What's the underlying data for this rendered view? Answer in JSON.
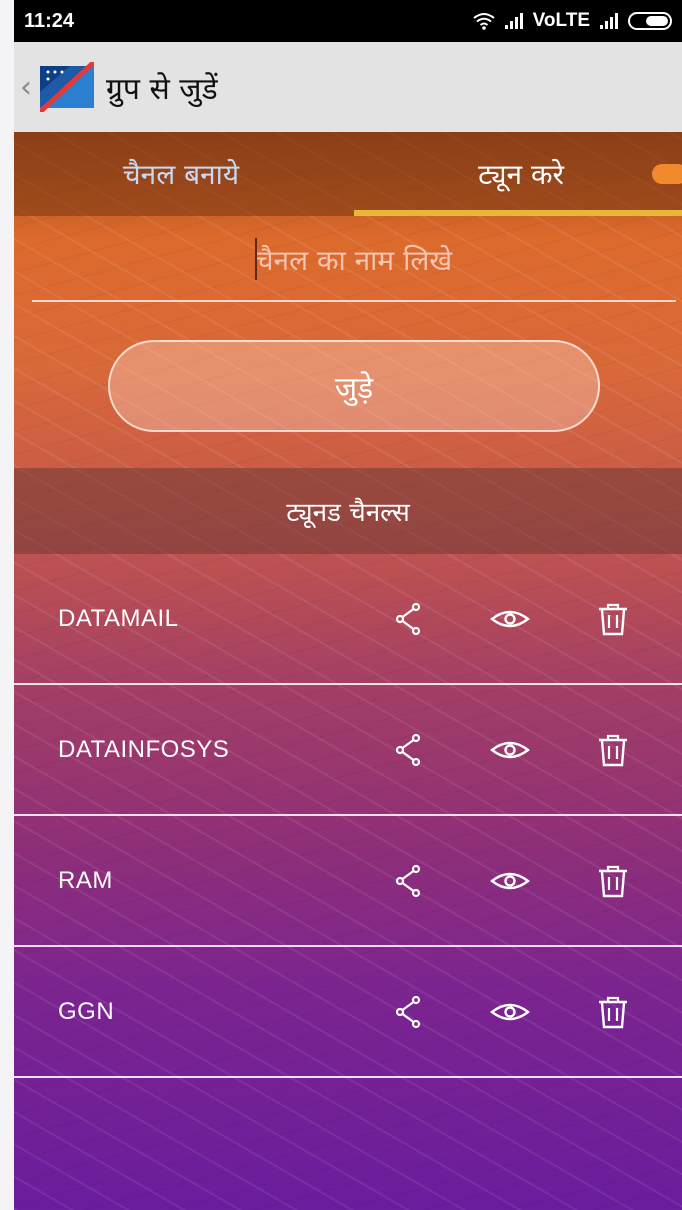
{
  "status_bar": {
    "time": "11:24",
    "network_label": "VoLTE"
  },
  "action_bar": {
    "back_icon": "chevron-left-icon",
    "title": "ग्रुप से जुडें"
  },
  "tabs": [
    {
      "label": "चैनल बनाये",
      "active": false
    },
    {
      "label": "ट्यून करे",
      "active": true
    }
  ],
  "form": {
    "channel_placeholder": "चैनल का नाम लिखे",
    "join_label": "जुड़े"
  },
  "section": {
    "title": "ट्यूनड चैनल्स"
  },
  "channels": [
    {
      "name": "DATAMAIL"
    },
    {
      "name": "DATAINFOSYS"
    },
    {
      "name": "RAM"
    },
    {
      "name": "GGN"
    }
  ],
  "colors": {
    "tab_indicator": "#e8b73a",
    "gradient_top": "#dc6a2c",
    "gradient_bottom": "#6a1d9c"
  }
}
